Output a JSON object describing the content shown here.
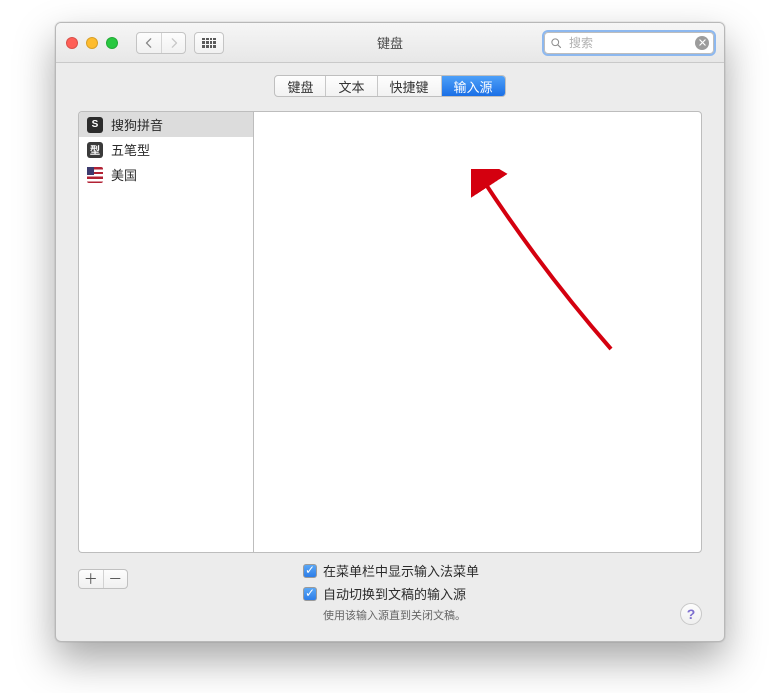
{
  "window": {
    "title": "键盘"
  },
  "toolbar": {
    "search_placeholder": "搜索"
  },
  "tabs": {
    "items": [
      {
        "label": "键盘",
        "active": false
      },
      {
        "label": "文本",
        "active": false
      },
      {
        "label": "快捷键",
        "active": false
      },
      {
        "label": "输入源",
        "active": true
      }
    ]
  },
  "sources": {
    "items": [
      {
        "icon": "sogou-icon",
        "glyph": "S",
        "label": "搜狗拼音",
        "selected": true
      },
      {
        "icon": "wubi-icon",
        "glyph": "型",
        "label": "五笔型",
        "selected": false
      },
      {
        "icon": "us-flag-icon",
        "glyph": "",
        "label": "美国",
        "selected": false
      }
    ]
  },
  "addremove": {
    "add": "＋",
    "remove": "－"
  },
  "options": {
    "show_menu": {
      "label": "在菜单栏中显示输入法菜单",
      "checked": true
    },
    "auto_switch": {
      "label": "自动切换到文稿的输入源",
      "checked": true
    },
    "hint": "使用该输入源直到关闭文稿。"
  },
  "help": {
    "label": "?"
  }
}
